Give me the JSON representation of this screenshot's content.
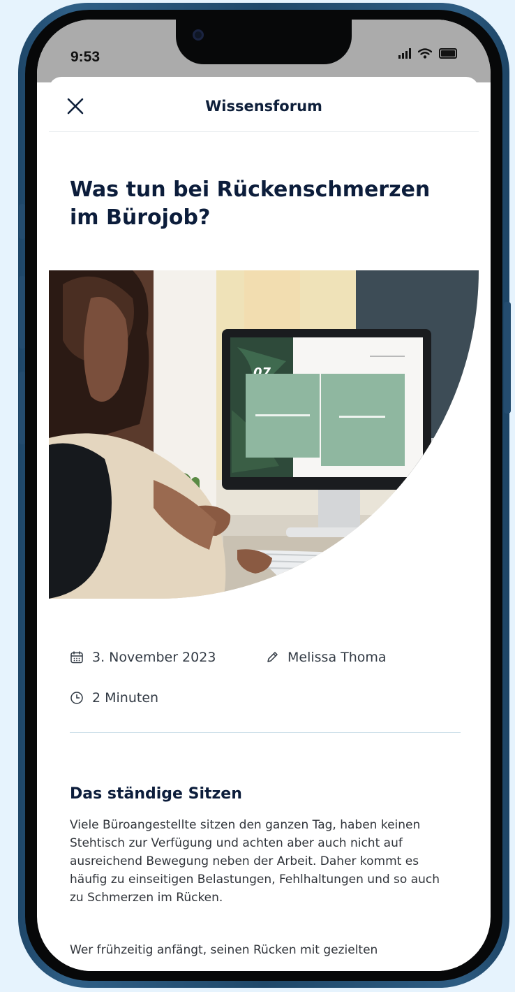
{
  "status_bar": {
    "time": "9:53"
  },
  "header": {
    "title": "Wissensforum"
  },
  "article": {
    "title": "Was tun bei Rückenschmerzen im Bürojob?",
    "date": "3. November 2023",
    "author": "Melissa Thoma",
    "read_time": "2 Minuten",
    "section_title": "Das ständige Sitzen",
    "paragraph_1": "Viele Büroangestellte sitzen den ganzen Tag, haben keinen Stehtisch zur Verfügung und achten aber auch nicht auf ausreichend Bewegung neben der Arbeit. Daher kommt es häufig zu einseitigen Belastungen, Fehlhaltungen und so auch zu Schmerzen im Rücken.",
    "paragraph_2": "Wer frühzeitig anfängt, seinen Rücken mit gezielten"
  },
  "hero_image": {
    "monitor_number": "07"
  },
  "colors": {
    "background": "#e6f3fd",
    "frame": "#244c6f",
    "title": "#0c1d3b",
    "divider": "#cfe1ea"
  },
  "icons": [
    "close-icon",
    "calendar-icon",
    "pencil-icon",
    "clock-icon",
    "signal-icon",
    "wifi-icon",
    "battery-icon"
  ]
}
